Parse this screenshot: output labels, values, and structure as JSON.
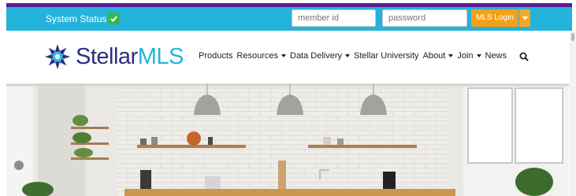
{
  "topbar": {
    "status_label": "System Status",
    "member_placeholder": "member id",
    "password_placeholder": "password",
    "login_label": "MLS Login"
  },
  "brand": {
    "name_part1": "Stellar",
    "name_part2": "MLS",
    "colors": {
      "navy": "#2d2e83",
      "cyan": "#24b3db",
      "purple": "#5a1e96",
      "orange": "#f5a01a"
    }
  },
  "nav": {
    "items": [
      {
        "label": "Products",
        "has_dropdown": false
      },
      {
        "label": "Resources",
        "has_dropdown": true
      },
      {
        "label": "Data Delivery",
        "has_dropdown": true
      },
      {
        "label": "Stellar University",
        "has_dropdown": false
      },
      {
        "label": "About",
        "has_dropdown": true
      },
      {
        "label": "Join",
        "has_dropdown": true
      },
      {
        "label": "News",
        "has_dropdown": false
      }
    ]
  },
  "icons": {
    "status": "check-icon",
    "search": "search-icon",
    "login_dropdown": "caret-down-icon",
    "logo": "star-logo-icon"
  }
}
